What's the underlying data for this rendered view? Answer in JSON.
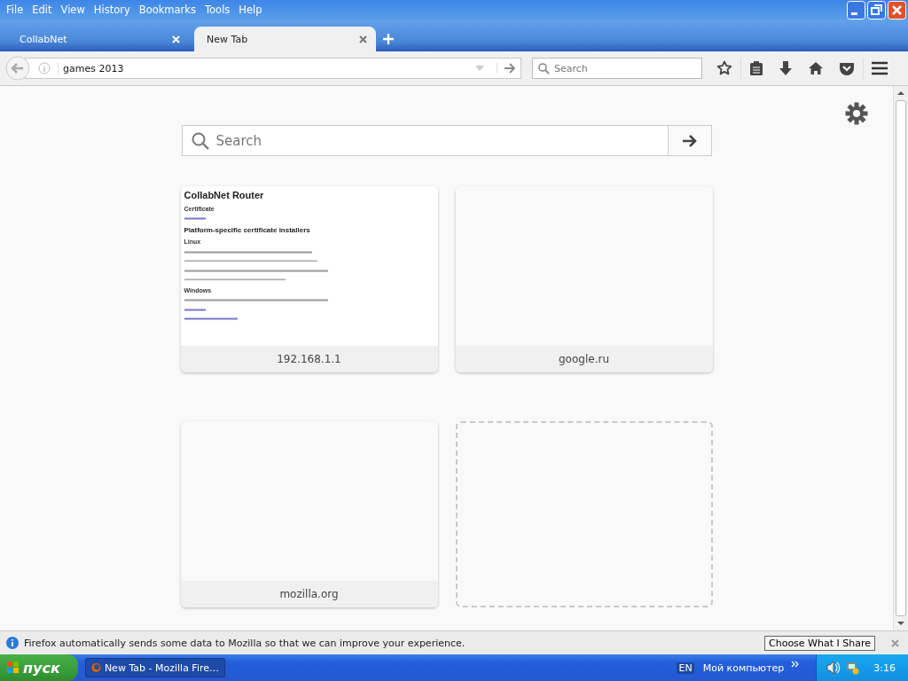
{
  "menu": [
    "File",
    "Edit",
    "View",
    "History",
    "Bookmarks",
    "Tools",
    "Help"
  ],
  "tabs": [
    {
      "label": "CollabNet",
      "selected": false
    },
    {
      "label": "New Tab",
      "selected": true
    }
  ],
  "toolbar": {
    "url": "games 2013",
    "search_placeholder": "Search"
  },
  "new_tab": {
    "search_placeholder": "Search",
    "tiles": [
      {
        "kind": "thumbnail",
        "title": "192.168.1.1",
        "preview": [
          {
            "kind": "h1",
            "text": "CollabNet Router"
          },
          {
            "kind": "h3",
            "text": "Certificate"
          },
          {
            "kind": "link"
          },
          {
            "kind": "h2",
            "text": "Platform-specific certificate installers"
          },
          {
            "kind": "h3",
            "text": "Linux"
          },
          {
            "kind": "p"
          },
          {
            "kind": "code"
          },
          {
            "kind": "p"
          },
          {
            "kind": "code"
          },
          {
            "kind": "h3",
            "text": "Windows"
          },
          {
            "kind": "p"
          },
          {
            "kind": "link"
          },
          {
            "kind": "link"
          }
        ]
      },
      {
        "kind": "blank",
        "title": "google.ru"
      },
      {
        "kind": "blank",
        "title": "mozilla.org"
      },
      {
        "kind": "empty"
      }
    ]
  },
  "notification": {
    "message": "Firefox automatically sends some data to Mozilla so that we can improve your experience.",
    "button": "Choose What I Share"
  },
  "taskbar": {
    "start": "пуск",
    "task": "New Tab - Mozilla Fire…",
    "language": "EN",
    "toolbar": "Мой компьютер",
    "clock": "3:16"
  }
}
